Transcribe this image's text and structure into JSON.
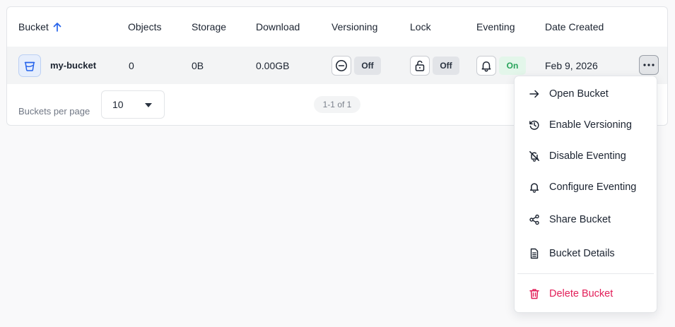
{
  "table": {
    "headers": {
      "bucket": "Bucket",
      "objects": "Objects",
      "storage": "Storage",
      "download": "Download",
      "versioning": "Versioning",
      "lock": "Lock",
      "eventing": "Eventing",
      "date_created": "Date Created"
    },
    "sort": {
      "column": "bucket",
      "direction": "ascending"
    },
    "rows": [
      {
        "name": "my-bucket",
        "objects": "0",
        "storage": "0B",
        "download": "0.00GB",
        "versioning": "Off",
        "lock": "Off",
        "eventing": "On",
        "date_created": "Feb 9, 2026"
      }
    ]
  },
  "footer": {
    "per_page_label": "Buckets per page",
    "per_page_value": "10",
    "range": "1-1 of 1"
  },
  "menu": {
    "items": [
      {
        "label": "Open Bucket",
        "icon": "arrow-right-icon"
      },
      {
        "label": "Enable Versioning",
        "icon": "history-icon"
      },
      {
        "label": "Disable Eventing",
        "icon": "bell-off-icon"
      },
      {
        "label": "Configure Eventing",
        "icon": "bell-icon"
      },
      {
        "label": "Share Bucket",
        "icon": "share-icon"
      },
      {
        "label": "Bucket Details",
        "icon": "document-icon"
      },
      {
        "label": "Delete Bucket",
        "icon": "trash-icon"
      }
    ]
  },
  "colors": {
    "accent": "#2563eb",
    "on_text": "#27a35a",
    "on_bg": "#e3f6ea",
    "danger": "#e21e58",
    "row_bg": "#f3f4f5"
  }
}
